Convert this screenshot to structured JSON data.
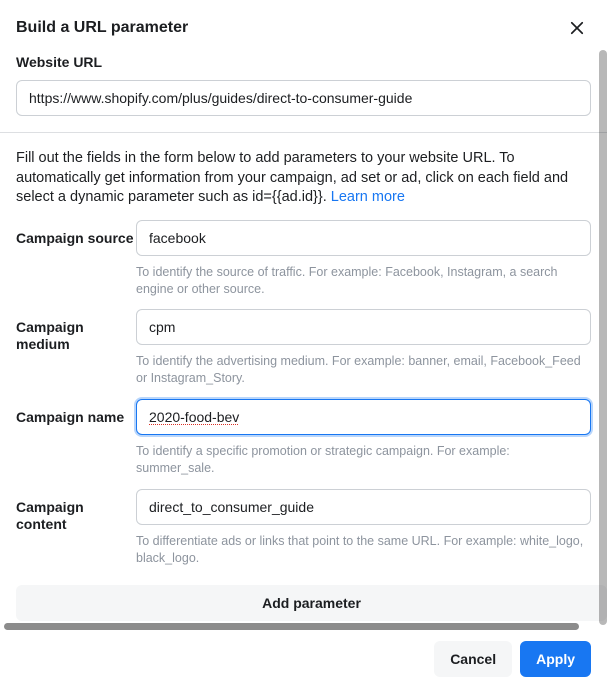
{
  "header": {
    "title": "Build a URL parameter"
  },
  "url": {
    "label": "Website URL",
    "value": "https://www.shopify.com/plus/guides/direct-to-consumer-guide"
  },
  "intro": {
    "text": "Fill out the fields in the form below to add parameters to your website URL. To automatically get information from your campaign, ad set or ad, click on each field and select a dynamic parameter such as id={{ad.id}}. ",
    "link_text": "Learn more"
  },
  "fields": {
    "source": {
      "label": "Campaign source",
      "value": "facebook",
      "help": "To identify the source of traffic. For example: Facebook, Instagram, a search engine or other source."
    },
    "medium": {
      "label": "Campaign medium",
      "value": "cpm",
      "help": "To identify the advertising medium. For example: banner, email, Facebook_Feed or Instagram_Story."
    },
    "name": {
      "label": "Campaign name",
      "value": "2020-food-bev",
      "help": "To identify a specific promotion or strategic campaign. For example: summer_sale."
    },
    "content": {
      "label": "Campaign content",
      "value": "direct_to_consumer_guide",
      "help": "To differentiate ads or links that point to the same URL. For example: white_logo, black_logo."
    }
  },
  "buttons": {
    "add_parameter": "Add parameter",
    "cancel": "Cancel",
    "apply": "Apply"
  }
}
